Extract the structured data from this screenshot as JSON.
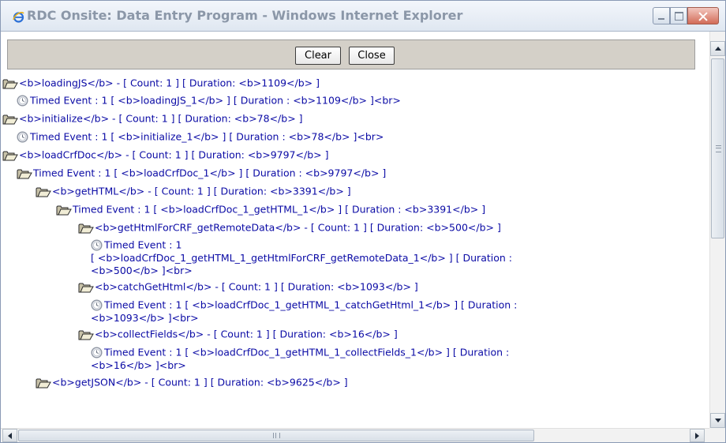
{
  "window": {
    "title": "RDC Onsite: Data Entry Program - Windows Internet Explorer",
    "icon": "ie-icon"
  },
  "toolbar": {
    "clear_label": "Clear",
    "close_label": "Close"
  },
  "log": [
    {
      "icon": "folder-open-icon",
      "text": "<b>loadingJS</b> - [ Count: 1 ] [ Duration: <b>1109</b> ]"
    },
    {
      "icon": "clock-icon",
      "text": "Timed Event : 1 [ <b>loadingJS_1</b> ] [ Duration : <b>1109</b> ]<br>"
    },
    {
      "icon": "folder-open-icon",
      "text": "<b>initialize</b> - [ Count: 1 ] [ Duration: <b>78</b> ]"
    },
    {
      "icon": "clock-icon",
      "text": "Timed Event : 1 [ <b>initialize_1</b> ] [ Duration : <b>78</b> ]<br>"
    },
    {
      "icon": "folder-open-icon",
      "text": "<b>loadCrfDoc</b> - [ Count: 1 ] [ Duration: <b>9797</b> ]"
    },
    {
      "icon": "folder-open-icon",
      "text": "Timed Event : 1 [ <b>loadCrfDoc_1</b> ] [ Duration : <b>9797</b> ]"
    },
    {
      "icon": "folder-open-icon",
      "text": "<b>getHTML</b> - [ Count: 1 ] [ Duration: <b>3391</b> ]"
    },
    {
      "icon": "folder-open-icon",
      "text": "Timed Event : 1 [ <b>loadCrfDoc_1_getHTML_1</b> ] [ Duration : <b>3391</b> ]"
    },
    {
      "icon": "folder-open-icon",
      "text": "<b>getHtmlForCRF_getRemoteData</b> - [ Count: 1 ] [ Duration: <b>500</b> ]"
    },
    {
      "icon": "clock-icon",
      "lines": [
        "Timed Event : 1",
        "[ <b>loadCrfDoc_1_getHTML_1_getHtmlForCRF_getRemoteData_1</b> ] [ Duration :",
        "<b>500</b> ]<br>"
      ]
    },
    {
      "icon": "folder-open-icon",
      "text": "<b>catchGetHtml</b> - [ Count: 1 ] [ Duration: <b>1093</b> ]"
    },
    {
      "icon": "clock-icon",
      "lines": [
        "Timed Event : 1 [ <b>loadCrfDoc_1_getHTML_1_catchGetHtml_1</b> ] [ Duration :",
        "<b>1093</b> ]<br>"
      ]
    },
    {
      "icon": "folder-open-icon",
      "text": "<b>collectFields</b> - [ Count: 1 ] [ Duration: <b>16</b> ]"
    },
    {
      "icon": "clock-icon",
      "lines": [
        "Timed Event : 1 [ <b>loadCrfDoc_1_getHTML_1_collectFields_1</b> ] [ Duration :",
        "<b>16</b> ]<br>"
      ]
    },
    {
      "icon": "folder-open-icon",
      "text": "<b>getJSON</b> - [ Count: 1 ] [ Duration: <b>9625</b> ]"
    }
  ],
  "colors": {
    "log_text": "#0a0aa5",
    "button_bar": "#d4d0c8",
    "title_text": "#8b97a8"
  }
}
